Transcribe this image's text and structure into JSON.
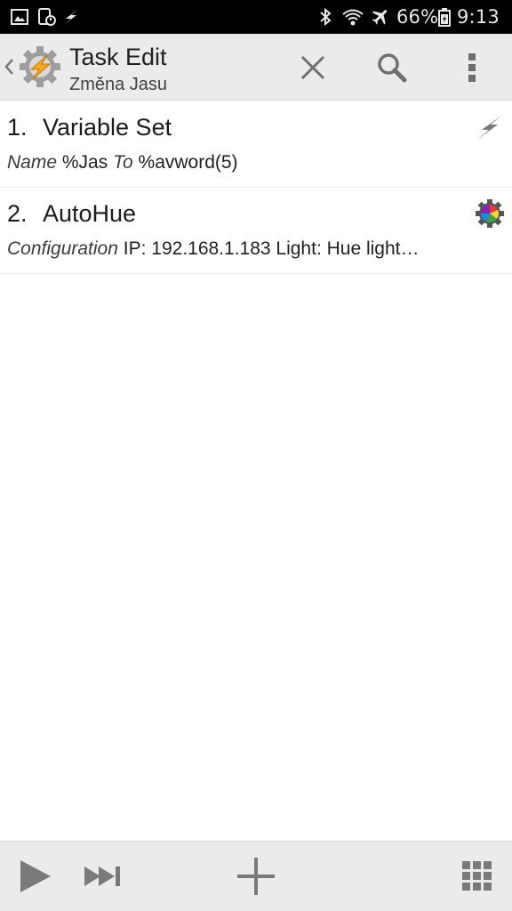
{
  "status_bar": {
    "battery_percent": "66%",
    "time": "9:13",
    "left_icons": [
      "gallery-icon",
      "screenshot-icon",
      "tasker-flash-icon"
    ],
    "right_icons": [
      "bluetooth-icon",
      "wifi-icon",
      "airplane-icon",
      "battery-icon"
    ]
  },
  "action_bar": {
    "title": "Task Edit",
    "subtitle": "Změna Jasu",
    "actions": [
      "close-icon",
      "search-icon",
      "overflow-menu-icon"
    ]
  },
  "actions": [
    {
      "number": "1.",
      "name": "Variable Set",
      "detail_label_1": "Name",
      "detail_value_1": "%Jas",
      "detail_label_2": "To",
      "detail_value_2": "%avword(5)",
      "icon": "flash-icon"
    },
    {
      "number": "2.",
      "name": "AutoHue",
      "detail_label_1": "Configuration",
      "detail_value_1": "IP: 192.168.1.183 Light: Hue light…",
      "icon": "autohue-plugin-icon"
    }
  ],
  "bottom_bar": {
    "buttons": [
      "play-icon",
      "step-icon",
      "add-icon",
      "grid-icon"
    ]
  },
  "colors": {
    "action_bar_bg": "#ebebeb",
    "status_bar_bg": "#000000",
    "tasker_orange": "#f5a623"
  }
}
